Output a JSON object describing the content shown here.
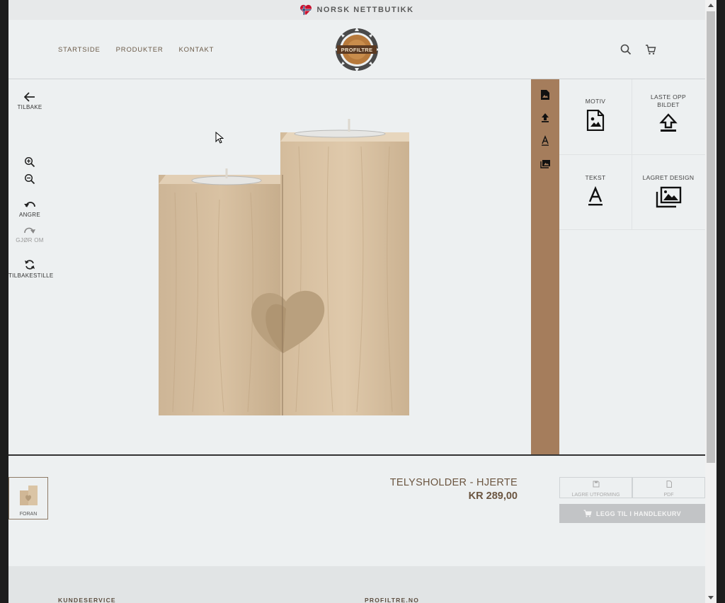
{
  "topbar": {
    "text": "NORSK NETTBUTIKK",
    "flag_icon": "heart-flag-icon"
  },
  "header": {
    "nav": [
      "STARTSIDE",
      "PRODUKTER",
      "KONTAKT"
    ],
    "logo_text": "PROFILTRE",
    "search_icon": "search-icon",
    "cart_icon": "cart-icon"
  },
  "left_tools": {
    "back": "TILBAKE",
    "undo": "ANGRE",
    "redo": "GJØR OM",
    "reset": "TILBAKESTILLE"
  },
  "panel": {
    "motiv": "MOTIV",
    "upload": "LASTE OPP BILDET",
    "text": "TEKST",
    "saved": "LAGRET DESIGN"
  },
  "product": {
    "title": "TELYSHOLDER - HJERTE",
    "price": "KR 289,00",
    "thumb_label": "FORAN"
  },
  "actions": {
    "save": "LAGRE UTFORMING",
    "pdf": "PDF",
    "add_to_cart": "LEGG TIL I HANDLEKURV"
  },
  "footer": {
    "col1": "KUNDESERVICE",
    "col2": "PROFILTRE.NO"
  },
  "colors": {
    "accent_brown": "#a57d5c",
    "text_brown": "#6b5540",
    "background": "#edf0f1"
  }
}
